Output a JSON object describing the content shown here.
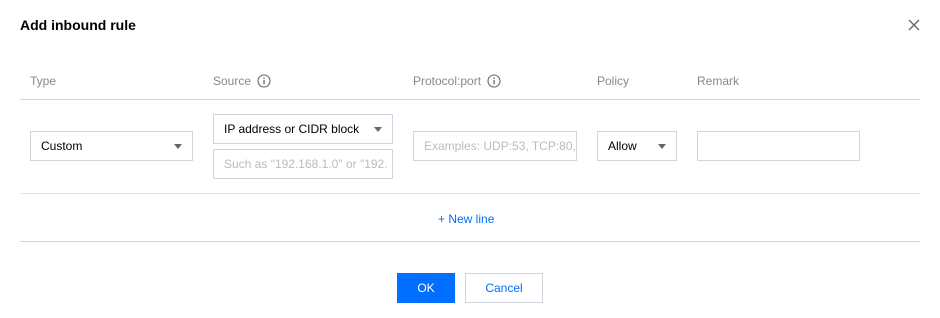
{
  "dialog": {
    "title": "Add inbound rule",
    "close_icon": "close-icon"
  },
  "table": {
    "columns": [
      {
        "label": "Type",
        "info_icon": false
      },
      {
        "label": "Source",
        "info_icon": true
      },
      {
        "label": "Protocol:port",
        "info_icon": true
      },
      {
        "label": "Policy",
        "info_icon": false
      },
      {
        "label": "Remark",
        "info_icon": false
      }
    ],
    "rows": [
      {
        "type": {
          "value": "Custom"
        },
        "source": {
          "selected": "IP address or CIDR block",
          "placeholder": "Such as \"192.168.1.0\" or \"192."
        },
        "protocol_port": {
          "placeholder": "Examples: UDP:53, TCP:80,"
        },
        "policy": {
          "value": "Allow"
        },
        "remark": {
          "value": ""
        }
      }
    ]
  },
  "add_line_label": "+ New line",
  "footer": {
    "ok_label": "OK",
    "cancel_label": "Cancel"
  },
  "colors": {
    "accent": "#006eff",
    "border": "#cfd5de",
    "header_text": "#888888",
    "placeholder_text": "#bbbbbb"
  }
}
